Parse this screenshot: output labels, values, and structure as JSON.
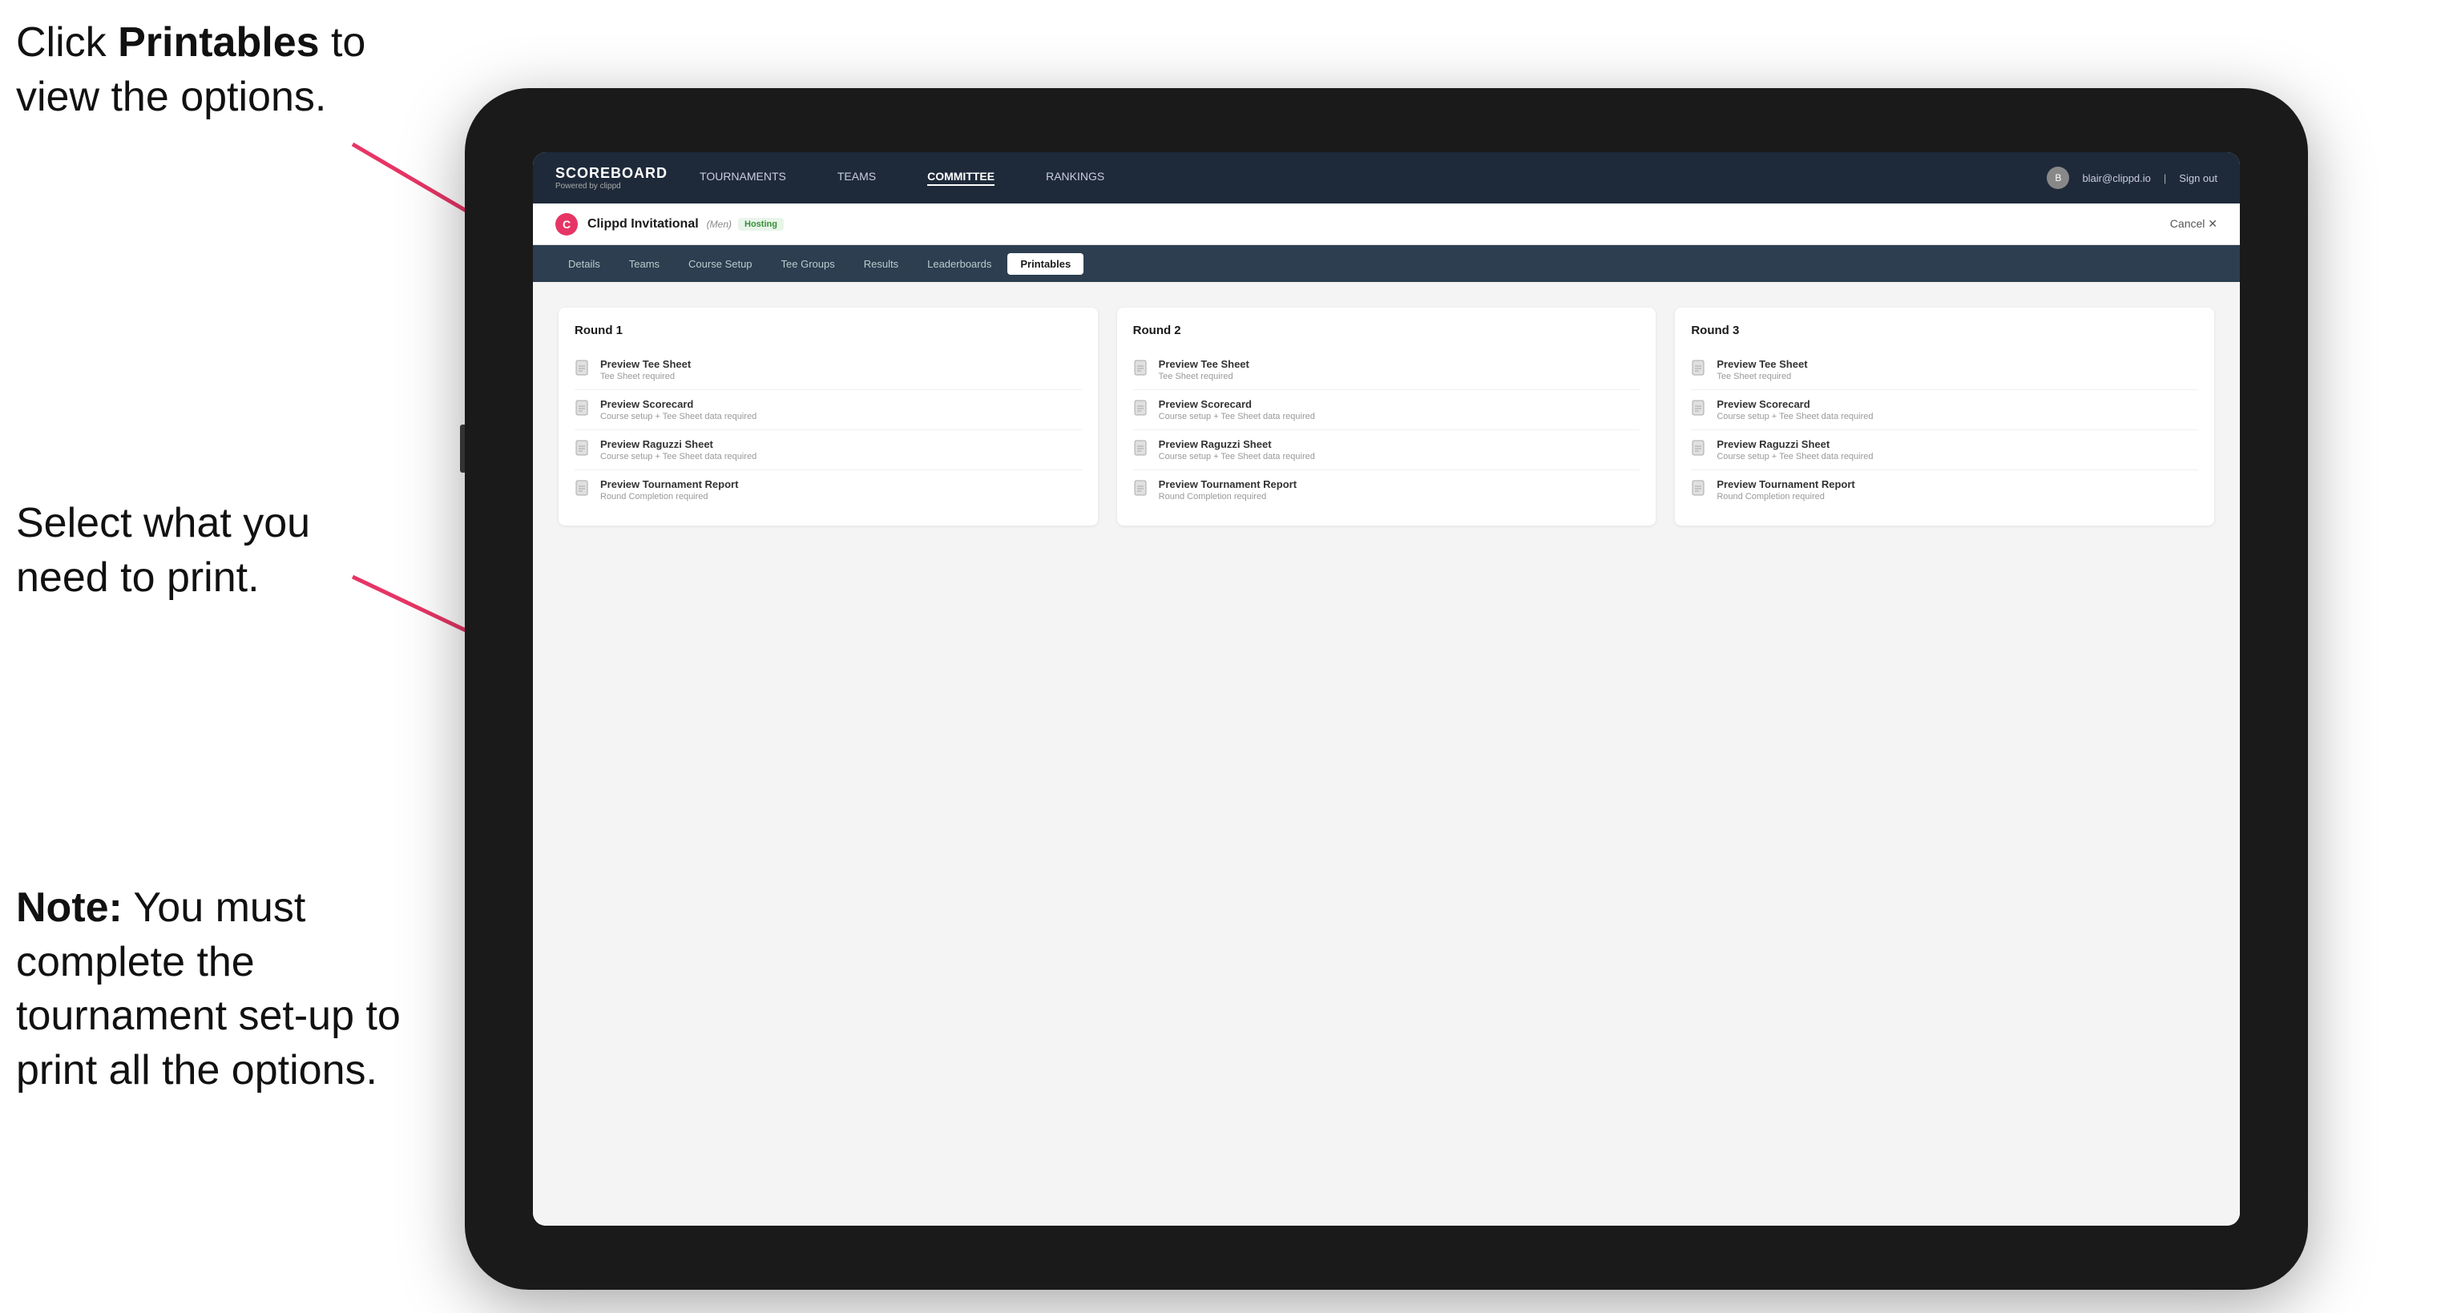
{
  "instructions": {
    "top": {
      "part1": "Click ",
      "bold": "Printables",
      "part2": " to",
      "line2": "view the options."
    },
    "mid": {
      "line1": "Select what you",
      "line2": "need to print."
    },
    "bottom": {
      "bold": "Note:",
      "rest": " You must complete the tournament set-up to print all the options."
    }
  },
  "nav": {
    "brand": "SCOREBOARD",
    "brand_sub": "Powered by clippd",
    "links": [
      "TOURNAMENTS",
      "TEAMS",
      "COMMITTEE",
      "RANKINGS"
    ],
    "active_link": "COMMITTEE",
    "user_email": "blair@clippd.io",
    "sign_out": "Sign out"
  },
  "tournament": {
    "name": "Clippd Invitational",
    "badge": "(Men)",
    "hosting": "Hosting",
    "cancel": "Cancel ✕"
  },
  "sub_tabs": {
    "tabs": [
      "Details",
      "Teams",
      "Course Setup",
      "Tee Groups",
      "Results",
      "Leaderboards",
      "Printables"
    ],
    "active": "Printables"
  },
  "rounds": [
    {
      "title": "Round 1",
      "items": [
        {
          "title": "Preview Tee Sheet",
          "sub": "Tee Sheet required"
        },
        {
          "title": "Preview Scorecard",
          "sub": "Course setup + Tee Sheet data required"
        },
        {
          "title": "Preview Raguzzi Sheet",
          "sub": "Course setup + Tee Sheet data required"
        },
        {
          "title": "Preview Tournament Report",
          "sub": "Round Completion required"
        }
      ]
    },
    {
      "title": "Round 2",
      "items": [
        {
          "title": "Preview Tee Sheet",
          "sub": "Tee Sheet required"
        },
        {
          "title": "Preview Scorecard",
          "sub": "Course setup + Tee Sheet data required"
        },
        {
          "title": "Preview Raguzzi Sheet",
          "sub": "Course setup + Tee Sheet data required"
        },
        {
          "title": "Preview Tournament Report",
          "sub": "Round Completion required"
        }
      ]
    },
    {
      "title": "Round 3",
      "items": [
        {
          "title": "Preview Tee Sheet",
          "sub": "Tee Sheet required"
        },
        {
          "title": "Preview Scorecard",
          "sub": "Course setup + Tee Sheet data required"
        },
        {
          "title": "Preview Raguzzi Sheet",
          "sub": "Course setup + Tee Sheet data required"
        },
        {
          "title": "Preview Tournament Report",
          "sub": "Round Completion required"
        }
      ]
    }
  ]
}
